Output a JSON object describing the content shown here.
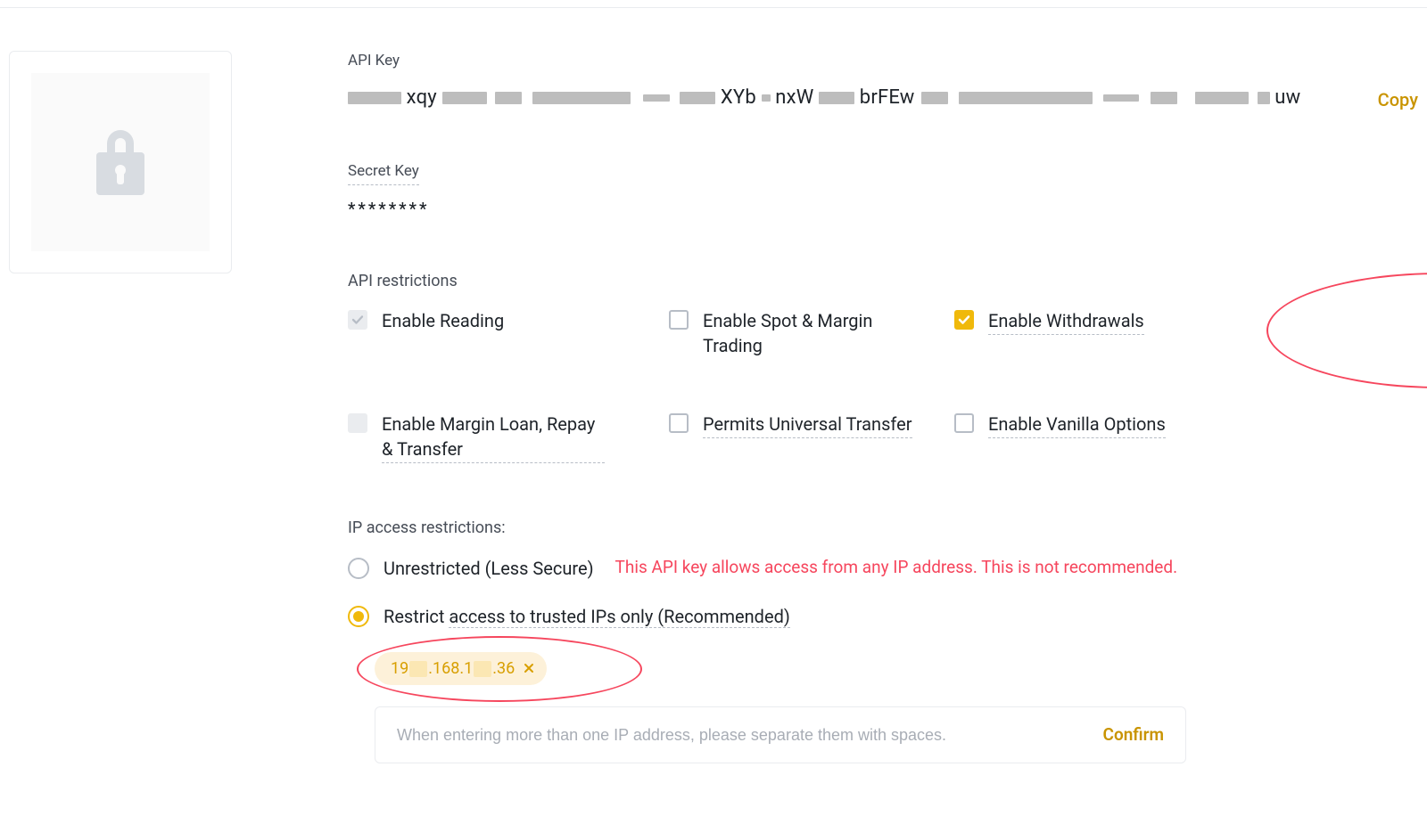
{
  "apiKey": {
    "label": "API Key",
    "segments": [
      "nxW",
      "brFEw",
      "uw"
    ],
    "copy": "Copy"
  },
  "secretKey": {
    "label": "Secret Key",
    "value": "********"
  },
  "restrictions": {
    "label": "API restrictions",
    "items": [
      {
        "id": "reading",
        "label": "Enable Reading",
        "state": "readonly",
        "dotted": false
      },
      {
        "id": "spot",
        "label": "Enable Spot & Margin Trading",
        "state": "unchecked",
        "dotted": false
      },
      {
        "id": "withdraw",
        "label": "Enable Withdrawals",
        "state": "checked",
        "dotted": true,
        "highlight": true
      },
      {
        "id": "margin",
        "label": "Enable Margin Loan, Repay & Transfer",
        "state": "unchecked",
        "dotted": true
      },
      {
        "id": "universal",
        "label": "Permits Universal Transfer",
        "state": "unchecked",
        "dotted": true
      },
      {
        "id": "vanilla",
        "label": "Enable Vanilla Options",
        "state": "unchecked",
        "dotted": true
      }
    ]
  },
  "ip": {
    "label": "IP access restrictions:",
    "options": [
      {
        "id": "unrestricted",
        "label": "Unrestricted (Less Secure)",
        "selected": false,
        "warning": "This API key allows access from any IP address. This is not recommended."
      },
      {
        "id": "restricted",
        "label_pre": "Restrict ",
        "label_dotted": "access to trusted IPs only (Recommended)",
        "selected": true
      }
    ],
    "chip": {
      "p1": "19",
      "p2": ".168.1",
      "p3": ".36"
    },
    "input_placeholder": "When entering more than one IP address, please separate them with spaces.",
    "confirm": "Confirm"
  },
  "icons": {
    "lock": "lock-icon",
    "check": "check-icon",
    "close": "close-icon"
  }
}
